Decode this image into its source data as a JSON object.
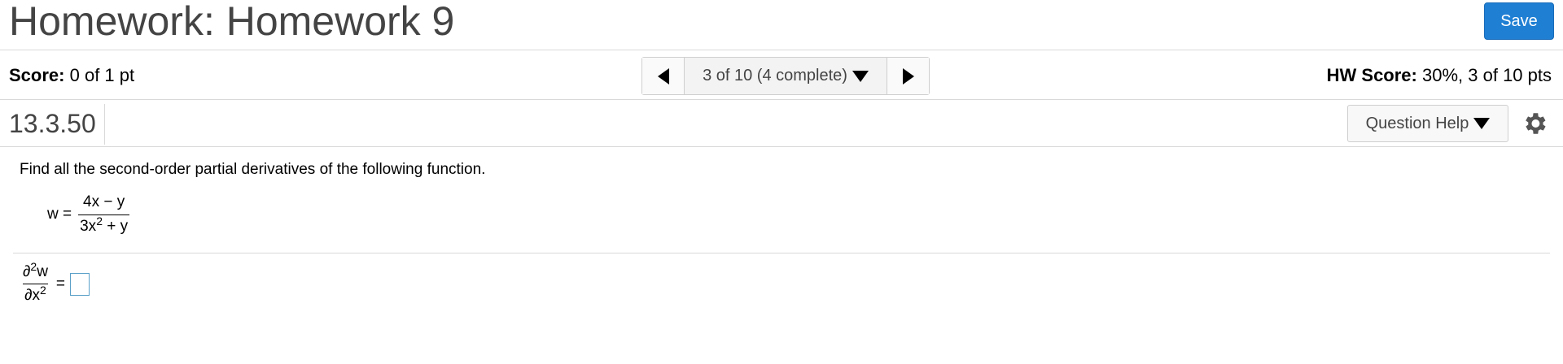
{
  "header": {
    "title": "Homework: Homework 9",
    "save_label": "Save"
  },
  "score": {
    "label": "Score:",
    "value": "0 of 1 pt",
    "hw_label": "HW Score:",
    "hw_value": "30%, 3 of 10 pts"
  },
  "navigation": {
    "position_text": "3 of 10 (4 complete)"
  },
  "question": {
    "number": "13.3.50",
    "help_label": "Question Help",
    "prompt": "Find all the second-order partial derivatives of the following function.",
    "function": {
      "lhs": "w =",
      "numerator": "4x − y",
      "denominator_base": "3x",
      "denominator_exp": "2",
      "denominator_rest": " + y"
    },
    "answer_row": {
      "top_symbol": "∂",
      "top_exp": "2",
      "top_var": "w",
      "bottom_symbol": "∂x",
      "bottom_exp": "2",
      "equals": "="
    }
  },
  "colors": {
    "save_button": "#1f7fd3",
    "input_border": "#5aa0c8"
  }
}
